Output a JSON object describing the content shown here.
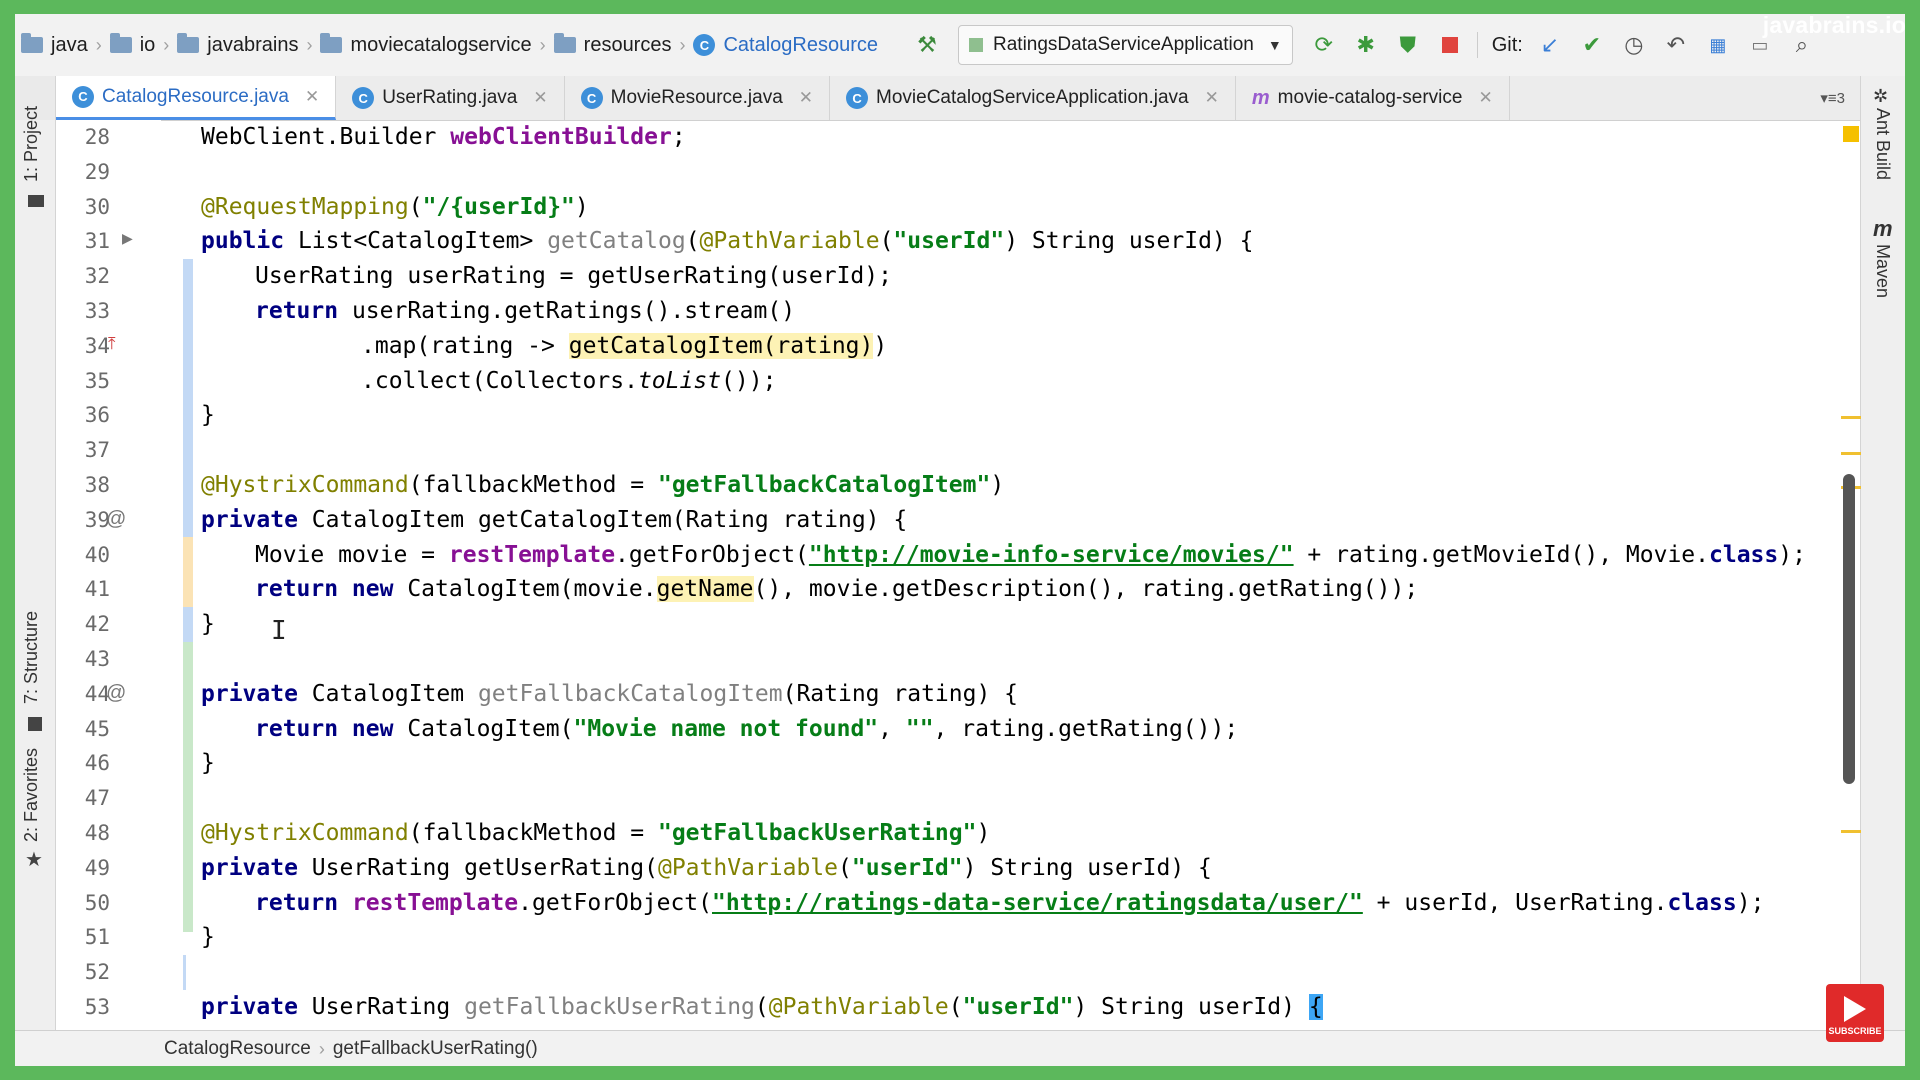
{
  "brand": "javabrains.io",
  "subscribe_label": "SUBSCRIBE",
  "navbar": {
    "crumbs": [
      "java",
      "io",
      "javabrains",
      "moviecatalogservice",
      "resources",
      "CatalogResource"
    ],
    "run_config": "RatingsDataServiceApplication",
    "git_label": "Git:"
  },
  "tabs": [
    {
      "label": "CatalogResource.java",
      "icon": "class-icon"
    },
    {
      "label": "UserRating.java",
      "icon": "class-icon"
    },
    {
      "label": "MovieResource.java",
      "icon": "class-icon"
    },
    {
      "label": "MovieCatalogServiceApplication.java",
      "icon": "spring-class-icon"
    },
    {
      "label": "movie-catalog-service",
      "icon": "maven-icon"
    }
  ],
  "tab_menu": "▾≡3",
  "left_tools": [
    "1: Project",
    "7: Structure",
    "2: Favorites"
  ],
  "right_tools": [
    "Ant Build",
    "Maven"
  ],
  "line_numbers": [
    "28",
    "29",
    "30",
    "31",
    "32",
    "33",
    "34",
    "35",
    "36",
    "37",
    "38",
    "39",
    "40",
    "41",
    "42",
    "43",
    "44",
    "45",
    "46",
    "47",
    "48",
    "49",
    "50",
    "51",
    "52",
    "53"
  ],
  "status": {
    "crumb1": "CatalogResource",
    "crumb2": "getFallbackUserRating()"
  }
}
